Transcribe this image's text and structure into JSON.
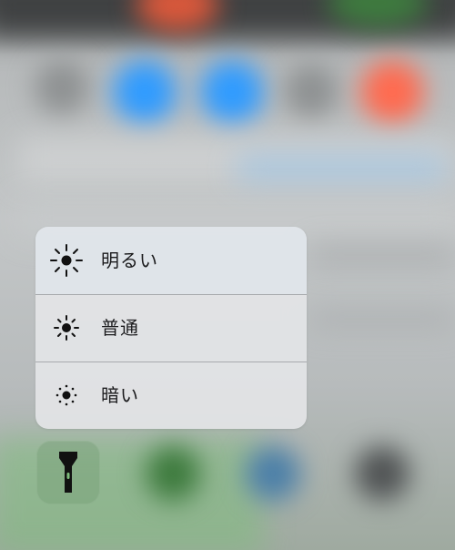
{
  "brightness_menu": {
    "items": [
      {
        "label": "明るい",
        "icon": "sun-large-icon"
      },
      {
        "label": "普通",
        "icon": "sun-medium-icon"
      },
      {
        "label": "暗い",
        "icon": "sun-small-icon"
      }
    ]
  },
  "flashlight_button": {
    "icon": "flashlight-icon"
  },
  "colors": {
    "background_blue": "#2f9bff",
    "background_orange": "#ff6a4f",
    "background_red": "#e05a3c",
    "background_green": "#4ab04a",
    "menu_background": "#e4e6e8",
    "text": "#1b1b1d",
    "flashlight_body": "#111111"
  }
}
